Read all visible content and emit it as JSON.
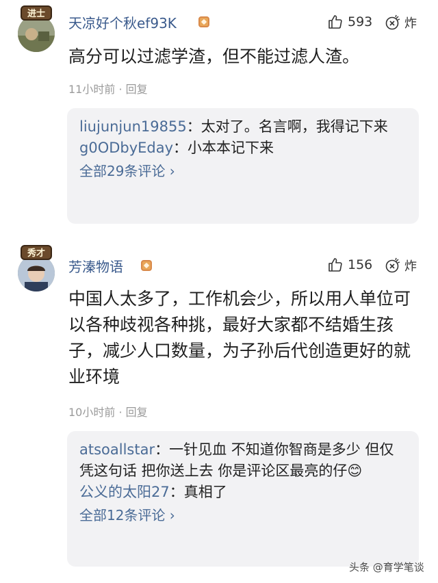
{
  "comments": [
    {
      "badge": "进士",
      "username": "天凉好个秋ef93K",
      "likes": "593",
      "boom_label": "炸",
      "text": "高分可以过滤学渣，但不能过滤人渣。",
      "time": "11小时前",
      "reply_label": "回复",
      "replies": [
        {
          "name": "liujunjun19855",
          "sep": "：",
          "text": "太对了。名言啊，我得记下来"
        },
        {
          "name": "g0ODbyEday",
          "sep": "：",
          "text": "小本本记下来"
        }
      ],
      "all_replies": "全部29条评论 ›"
    },
    {
      "badge": "秀才",
      "username": "芳溱物语",
      "likes": "156",
      "boom_label": "炸",
      "text": "中国人太多了，工作机会少，所以用人单位可以各种歧视各种挑，最好大家都不结婚生孩子，减少人口数量，为子孙后代创造更好的就业环境",
      "time": "10小时前",
      "reply_label": "回复",
      "replies": [
        {
          "name": "atsoallstar",
          "sep": "：",
          "text": "一针见血 不知道你智商是多少 但仅凭这句话 把你送上去 你是评论区最亮的仔😊"
        },
        {
          "name": "公义的太阳27",
          "sep": "：",
          "text": "真相了"
        }
      ],
      "all_replies": "全部12条评论 ›"
    }
  ],
  "watermark": "头条 @育学笔谈",
  "colors": {
    "username": "#3a5a8c",
    "reply_name": "#4a6b96",
    "meta": "#9a9a9a",
    "reply_bg": "#f2f2f4"
  }
}
